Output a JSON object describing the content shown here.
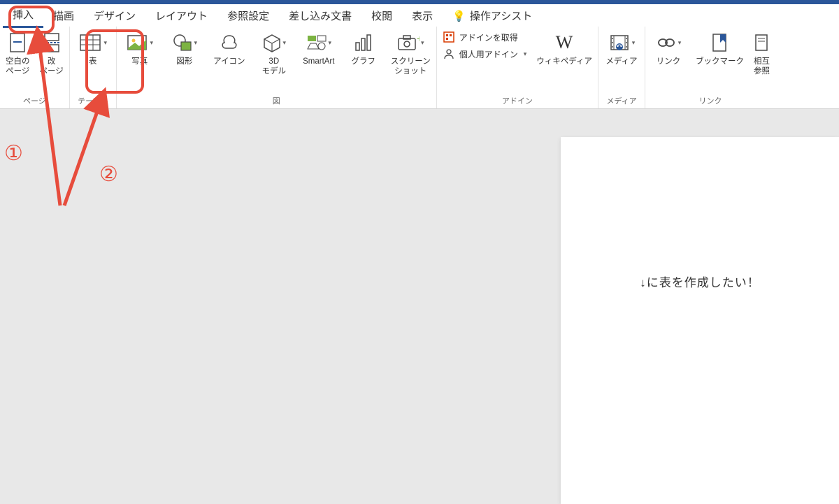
{
  "tabs": {
    "insert": "挿入",
    "draw": "描画",
    "design": "デザイン",
    "layout": "レイアウト",
    "references": "参照設定",
    "mailings": "差し込み文書",
    "review": "校閲",
    "view": "表示",
    "assist": "操作アシスト"
  },
  "ribbon": {
    "pages_group": "ページ",
    "blank_page": "空白の\nページ",
    "page_break": "改\nページ",
    "table_group": "テーブル",
    "table": "表",
    "illustrations_group": "図",
    "pictures": "写真",
    "shapes": "図形",
    "icons": "アイコン",
    "model3d": "3D\nモデル",
    "smartart": "SmartArt",
    "chart": "グラフ",
    "screenshot": "スクリーン\nショット",
    "addins_group": "アドイン",
    "get_addins": "アドインを取得",
    "my_addins": "個人用アドイン",
    "wikipedia": "ウィキペディア",
    "media_group": "メディア",
    "media": "メディア",
    "links_group": "リンク",
    "link": "リンク",
    "bookmark": "ブックマーク",
    "crossref": "相互\n参照"
  },
  "doc": {
    "text": "↓に表を作成したい！"
  },
  "annot": {
    "one": "①",
    "two": "②"
  }
}
